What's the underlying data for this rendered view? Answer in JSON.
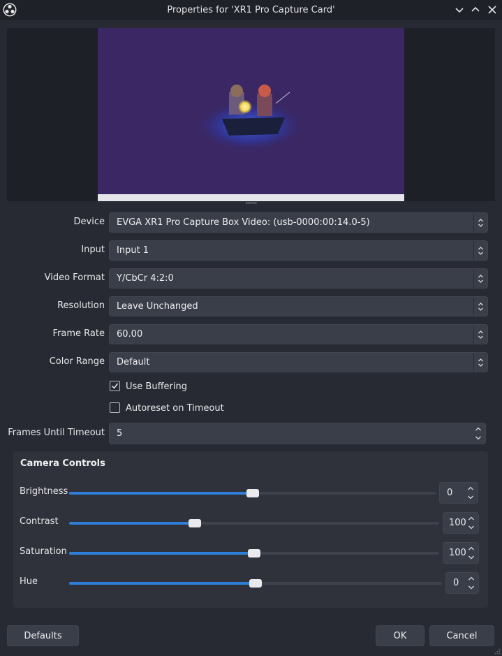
{
  "window": {
    "title": "Properties for 'XR1 Pro Capture Card'"
  },
  "fields": {
    "device": {
      "label": "Device",
      "value": "EVGA XR1 Pro Capture Box Video: (usb-0000:00:14.0-5)"
    },
    "input": {
      "label": "Input",
      "value": "Input 1"
    },
    "video_format": {
      "label": "Video Format",
      "value": "Y/CbCr 4:2:0"
    },
    "resolution": {
      "label": "Resolution",
      "value": "Leave Unchanged"
    },
    "frame_rate": {
      "label": "Frame Rate",
      "value": "60.00"
    },
    "color_range": {
      "label": "Color Range",
      "value": "Default"
    },
    "use_buffering": {
      "label": "Use Buffering",
      "checked": true
    },
    "autoreset": {
      "label": "Autoreset on Timeout",
      "checked": false
    },
    "frames_until_timeout": {
      "label": "Frames Until Timeout",
      "value": "5"
    }
  },
  "camera_controls": {
    "title": "Camera Controls",
    "sliders": [
      {
        "label": "Brightness",
        "value": "0",
        "fraction": 0.5
      },
      {
        "label": "Contrast",
        "value": "100",
        "fraction": 0.34
      },
      {
        "label": "Saturation",
        "value": "100",
        "fraction": 0.5
      },
      {
        "label": "Hue",
        "value": "0",
        "fraction": 0.5
      }
    ]
  },
  "buttons": {
    "defaults": "Defaults",
    "ok": "OK",
    "cancel": "Cancel"
  },
  "colors": {
    "accent": "#2f7fd8",
    "background": "#272a33",
    "preview_bg": "#3a2763"
  }
}
